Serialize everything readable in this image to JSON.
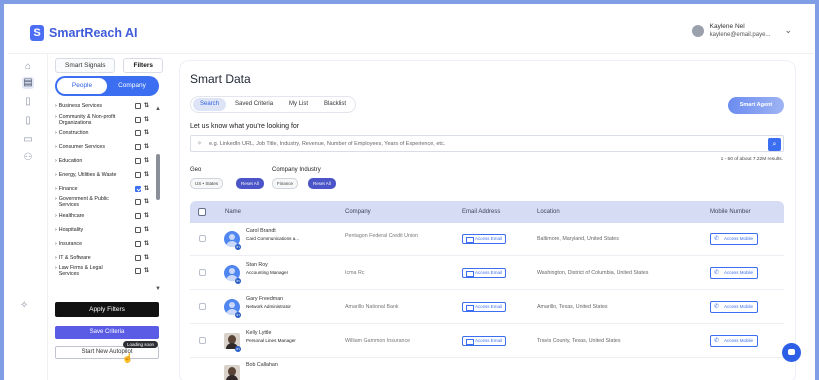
{
  "app": {
    "name": "SmartReach AI"
  },
  "user": {
    "name": "Kaylene Nel",
    "email": "kaylene@email.paye..."
  },
  "filters": {
    "tabs": [
      "Smart Signals",
      "Filters"
    ],
    "toggle": [
      "People",
      "Company"
    ],
    "items": [
      {
        "label": "Business Services",
        "checked": false
      },
      {
        "label": "Community & Non-profit Organizations",
        "checked": false
      },
      {
        "label": "Construction",
        "checked": false
      },
      {
        "label": "Consumer Services",
        "checked": false
      },
      {
        "label": "Education",
        "checked": false
      },
      {
        "label": "Energy, Utilities & Waste",
        "checked": false
      },
      {
        "label": "Finance",
        "checked": true
      },
      {
        "label": "Government & Public Services",
        "checked": false
      },
      {
        "label": "Healthcare",
        "checked": false
      },
      {
        "label": "Hospitality",
        "checked": false
      },
      {
        "label": "Insurance",
        "checked": false
      },
      {
        "label": "IT & Software",
        "checked": false
      },
      {
        "label": "Law Firms & Legal Services",
        "checked": false
      }
    ],
    "apply": "Apply Filters",
    "save": "Save Criteria",
    "start": "Start New Autopilot",
    "loading": "Loading soon"
  },
  "main": {
    "title": "Smart Data",
    "tabs": [
      "Search",
      "Saved Criteria",
      "My List",
      "Blacklist"
    ],
    "agent_button": "Smart Agent",
    "prompt": "Let us know what you're looking for",
    "search_placeholder": "e.g. LinkedIn URL, Job Title, Industry, Revenue, Number of Employees, Years of Experience, etc.",
    "results": "1 - 50 of about 7.22M results.",
    "geo_label": "Geo",
    "geo_chip": "US • States",
    "geo_reset": "Reset All",
    "industry_label": "Company Industry",
    "industry_chip": "Finance",
    "industry_reset": "Reset All",
    "columns": [
      "Name",
      "Company",
      "Email Address",
      "Location",
      "Mobile Number"
    ],
    "email_btn": "Access Email",
    "mobile_btn": "Access Mobile",
    "rows": [
      {
        "name": "Carol Brandt",
        "title": "Card Communications a...",
        "company": "Pentagon Federal Credit Union",
        "location": "Baltimore, Maryland, United States",
        "photo": false
      },
      {
        "name": "Stan Roy",
        "title": "Accounting Manager",
        "company": "Icma Rc",
        "location": "Washington, District of Columbia, United States",
        "photo": false
      },
      {
        "name": "Gary Freedman",
        "title": "Network Administrator",
        "company": "Amarillo National Bank",
        "location": "Amarillo, Texas, United States",
        "photo": false
      },
      {
        "name": "Kelly Lyttle",
        "title": "Personal Lines Manager",
        "company": "William Gammon Insurance",
        "location": "Travis County, Texas, United States",
        "photo": true
      },
      {
        "name": "Bob Callahan",
        "title": "",
        "company": "",
        "location": "",
        "photo": true
      }
    ]
  }
}
